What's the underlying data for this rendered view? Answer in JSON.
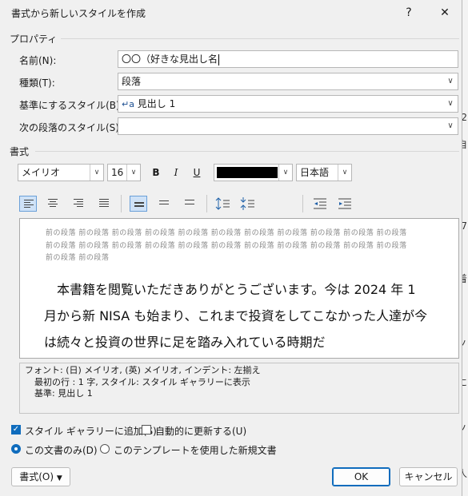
{
  "window": {
    "title": "書式から新しいスタイルを作成",
    "help_label": "?",
    "close_label": "✕"
  },
  "properties": {
    "section_label": "プロパティ",
    "name_label": "名前(N):",
    "name_value": "〇〇（好きな見出し名",
    "type_label": "種類(T):",
    "type_value": "段落",
    "base_label": "基準にするスタイル(B):",
    "base_value": "見出し 1",
    "base_icon_glyph": "↵a",
    "next_label": "次の段落のスタイル(S):",
    "next_value": ""
  },
  "format": {
    "section_label": "書式",
    "font": "メイリオ",
    "size": "16",
    "bold": "B",
    "italic": "I",
    "underline": "U",
    "color": "#000000",
    "language": "日本語"
  },
  "preview": {
    "previous_text": "前の段落 前の段落 前の段落 前の段落 前の段落 前の段落 前の段落 前の段落 前の段落 前の段落 前の段落 前の段落 前の段落 前の段落 前の段落 前の段落 前の段落 前の段落 前の段落 前の段落 前の段落 前の段落 前の段落 前の段落",
    "sample_text": "本書籍を閲覧いただきありがとうございます。今は 2024 年 1 月から新 NISA も始まり、これまで投資をしてこなかった人達が今は続々と投資の世界に足を踏み入れている時期だ"
  },
  "description": {
    "line1": "フォント: (日) メイリオ, (英) メイリオ, インデント: 左揃え",
    "line2": "最初の行 :  1 字, スタイル: スタイル ギャラリーに表示",
    "line3": "基準: 見出し 1"
  },
  "options": {
    "add_gallery": "スタイル ギャラリーに追加(S)",
    "auto_update": "自動的に更新する(U)",
    "this_doc_only": "この文書のみ(D)",
    "template_docs": "このテンプレートを使用した新規文書"
  },
  "buttons": {
    "format": "書式(O)",
    "ok": "OK",
    "cancel": "キャンセル"
  },
  "background_doc": {
    "chars": [
      "2",
      "自",
      "7",
      "着",
      "ノ",
      "に",
      "ノ",
      "人"
    ]
  }
}
